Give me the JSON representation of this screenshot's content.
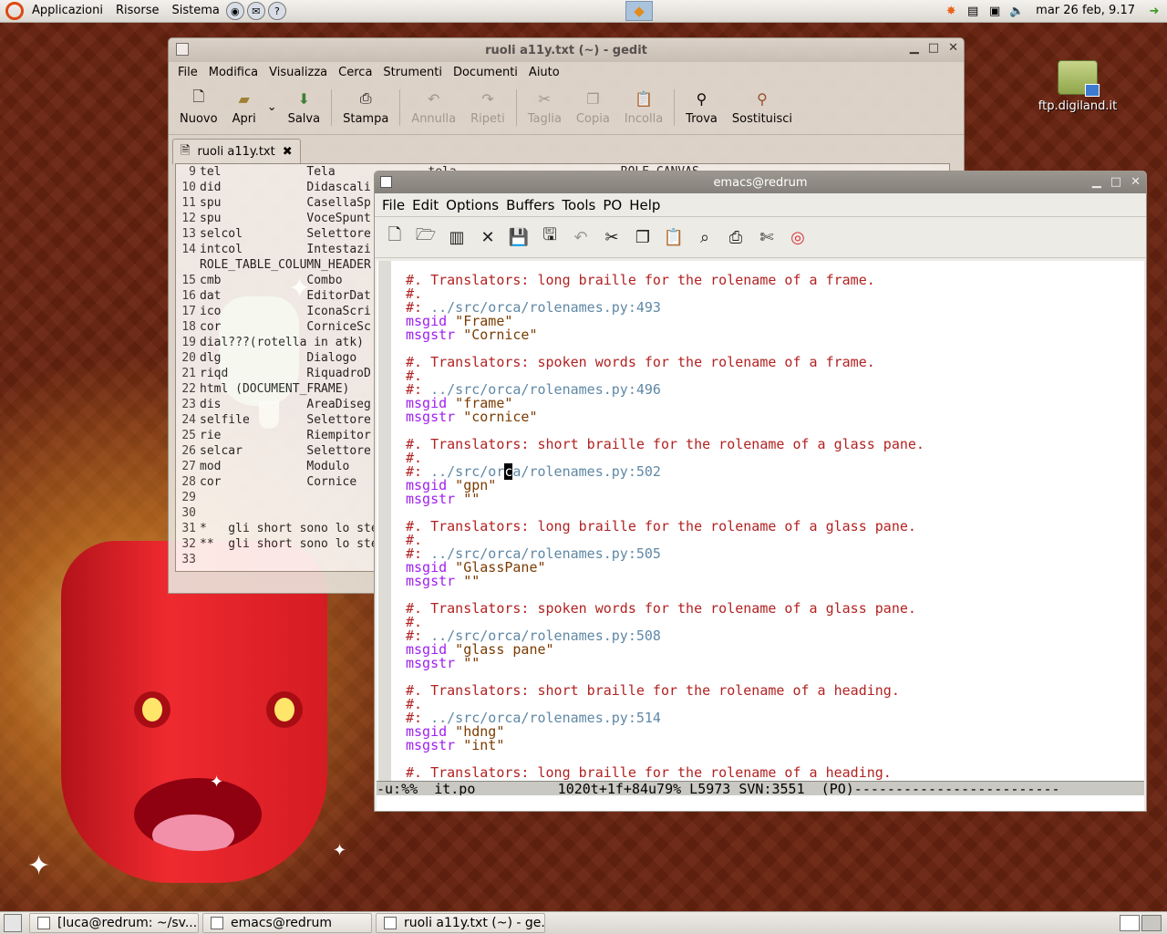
{
  "top_panel": {
    "menus": [
      "Applicazioni",
      "Risorse",
      "Sistema"
    ],
    "clock": "mar 26 feb,  9.17"
  },
  "desktop": {
    "icons": [
      {
        "label": "ftp.digiland.it"
      }
    ]
  },
  "gedit": {
    "title": "ruoli a11y.txt (~) - gedit",
    "menu": [
      "File",
      "Modifica",
      "Visualizza",
      "Cerca",
      "Strumenti",
      "Documenti",
      "Aiuto"
    ],
    "toolbar": {
      "nuovo": "Nuovo",
      "apri": "Apri",
      "salva": "Salva",
      "stampa": "Stampa",
      "annulla": "Annulla",
      "ripeti": "Ripeti",
      "taglia": "Taglia",
      "copia": "Copia",
      "incolla": "Incolla",
      "trova": "Trova",
      "sostituisci": "Sostituisci"
    },
    "tab_label": "ruoli a11y.txt",
    "lines": [
      {
        "n": "9",
        "t": "tel            Tela             tela                       ROLE_CANVAS"
      },
      {
        "n": "10",
        "t": "did            Didascali"
      },
      {
        "n": "11",
        "t": "spu            CasellaSp"
      },
      {
        "n": "12",
        "t": "spu            VoceSpunt"
      },
      {
        "n": "13",
        "t": "selcol         Selettore"
      },
      {
        "n": "14",
        "t": "intcol         Intestazi"
      },
      {
        "n": "",
        "t": "ROLE_TABLE_COLUMN_HEADER"
      },
      {
        "n": "15",
        "t": "cmb            Combo"
      },
      {
        "n": "16",
        "t": "dat            EditorDat"
      },
      {
        "n": "17",
        "t": "ico            IconaScri"
      },
      {
        "n": "18",
        "t": "cor            CorniceSc"
      },
      {
        "n": "19",
        "t": "dial???(rotella in atk)"
      },
      {
        "n": "20",
        "t": "dlg            Dialogo"
      },
      {
        "n": "21",
        "t": "riqd           RiquadroD"
      },
      {
        "n": "22",
        "t": "html (DOCUMENT_FRAME)"
      },
      {
        "n": "23",
        "t": "dis            AreaDiseg"
      },
      {
        "n": "24",
        "t": "selfile        Selettore"
      },
      {
        "n": "25",
        "t": "rie            Riempitor"
      },
      {
        "n": "26",
        "t": "selcar         Selettore"
      },
      {
        "n": "27",
        "t": "mod            Modulo"
      },
      {
        "n": "28",
        "t": "cor            Cornice"
      },
      {
        "n": "29",
        "t": ""
      },
      {
        "n": "30",
        "t": ""
      },
      {
        "n": "31",
        "t": "*   gli short sono lo ste"
      },
      {
        "n": "32",
        "t": "**  gli short sono lo ste"
      },
      {
        "n": "33",
        "t": ""
      }
    ]
  },
  "emacs": {
    "title": "emacs@redrum",
    "menu": [
      "File",
      "Edit",
      "Options",
      "Buffers",
      "Tools",
      "PO",
      "Help"
    ],
    "modeline": "-u:%%  it.po          1020t+1f+84u79% L5973 SVN:3551  (PO)-------------------------",
    "cursor_char": "c",
    "lines": [
      {
        "a": "#. Translators: long braille for the rolename of a frame."
      },
      {
        "a": "#."
      },
      {
        "a": "#: ",
        "b": "../src/orca/rolenames.py:493"
      },
      {
        "k": "msgid",
        "s": " \"Frame\""
      },
      {
        "k": "msgstr",
        "s": " \"Cornice\""
      },
      {},
      {
        "a": "#. Translators: spoken words for the rolename of a frame."
      },
      {
        "a": "#."
      },
      {
        "a": "#: ",
        "b": "../src/orca/rolenames.py:496"
      },
      {
        "k": "msgid",
        "s": " \"frame\""
      },
      {
        "k": "msgstr",
        "s": " \"cornice\""
      },
      {},
      {
        "a": "#. Translators: short braille for the rolename of a glass pane."
      },
      {
        "a": "#."
      },
      {
        "a": "#: ",
        "b": "../src/or",
        "c": "c",
        "d": "a/rolenames.py:502"
      },
      {
        "k": "msgid",
        "s": " \"gpn\""
      },
      {
        "k": "msgstr",
        "s": " \"\""
      },
      {},
      {
        "a": "#. Translators: long braille for the rolename of a glass pane."
      },
      {
        "a": "#."
      },
      {
        "a": "#: ",
        "b": "../src/orca/rolenames.py:505"
      },
      {
        "k": "msgid",
        "s": " \"GlassPane\""
      },
      {
        "k": "msgstr",
        "s": " \"\""
      },
      {},
      {
        "a": "#. Translators: spoken words for the rolename of a glass pane."
      },
      {
        "a": "#."
      },
      {
        "a": "#: ",
        "b": "../src/orca/rolenames.py:508"
      },
      {
        "k": "msgid",
        "s": " \"glass pane\""
      },
      {
        "k": "msgstr",
        "s": " \"\""
      },
      {},
      {
        "a": "#. Translators: short braille for the rolename of a heading."
      },
      {
        "a": "#."
      },
      {
        "a": "#: ",
        "b": "../src/orca/rolenames.py:514"
      },
      {
        "k": "msgid",
        "s": " \"hdng\""
      },
      {
        "k": "msgstr",
        "s": " \"int\""
      },
      {},
      {
        "a": "#. Translators: long braille for the rolename of a heading."
      }
    ]
  },
  "taskbar": {
    "tasks": [
      "[luca@redrum: ~/sv...",
      "emacs@redrum",
      "ruoli a11y.txt (~) - ge..."
    ]
  },
  "colors": {
    "comment": "#b22222",
    "reference": "#5f88a6",
    "keyword": "#a020f0",
    "string": "#7a3b00"
  }
}
